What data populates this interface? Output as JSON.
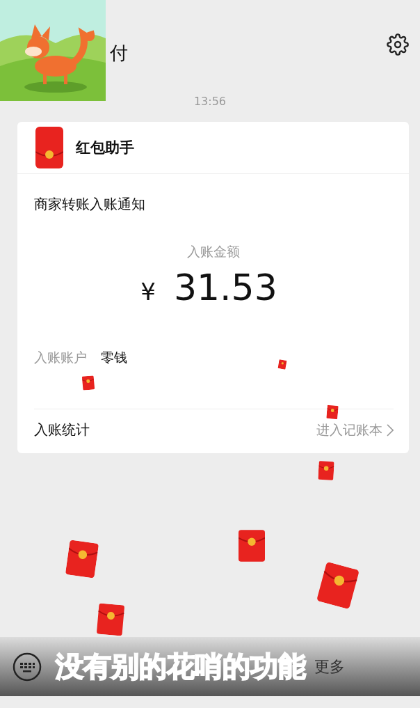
{
  "header": {
    "title": "付"
  },
  "timestamp": "13:56",
  "card": {
    "sender": "红包助手",
    "notice_title": "商家转账入账通知",
    "amount_label": "入账金额",
    "currency": "¥",
    "amount": "31.53",
    "details": [
      {
        "label": "入账账户",
        "value": "零钱"
      }
    ],
    "footer": {
      "label": "入账统计",
      "link": "进入记账本"
    }
  },
  "bottom_bar": {
    "more": "更多"
  },
  "caption": "没有别的花哨的功能"
}
